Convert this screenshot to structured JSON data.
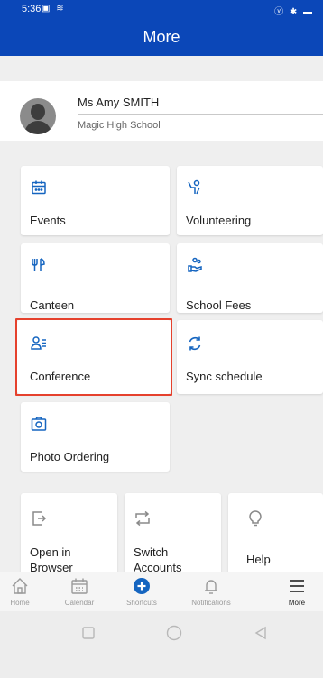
{
  "status_bar": {
    "time": "5:36",
    "left_icons": "▣ ≋",
    "right_icons": "ⓥ ✱ ▬"
  },
  "app_bar": {
    "title": "More"
  },
  "profile": {
    "name": "Ms Amy SMITH",
    "school": "Magic High School"
  },
  "tiles": {
    "events": "Events",
    "volunteering": "Volunteering",
    "canteen": "Canteen",
    "school_fees": "School Fees",
    "conference": "Conference",
    "sync_schedule": "Sync schedule",
    "photo_ordering": "Photo Ordering"
  },
  "actions": {
    "open_browser_l1": "Open in",
    "open_browser_l2": "Browser",
    "switch_accounts_l1": "Switch",
    "switch_accounts_l2": "Accounts",
    "help": "Help"
  },
  "bottom_nav": {
    "home": "Home",
    "calendar": "Calendar",
    "shortcuts": "Shortcuts",
    "notifications": "Notifications",
    "more": "More"
  },
  "colors": {
    "primary": "#0b47b8",
    "accent": "#1565c0",
    "highlight": "#e5412d"
  }
}
